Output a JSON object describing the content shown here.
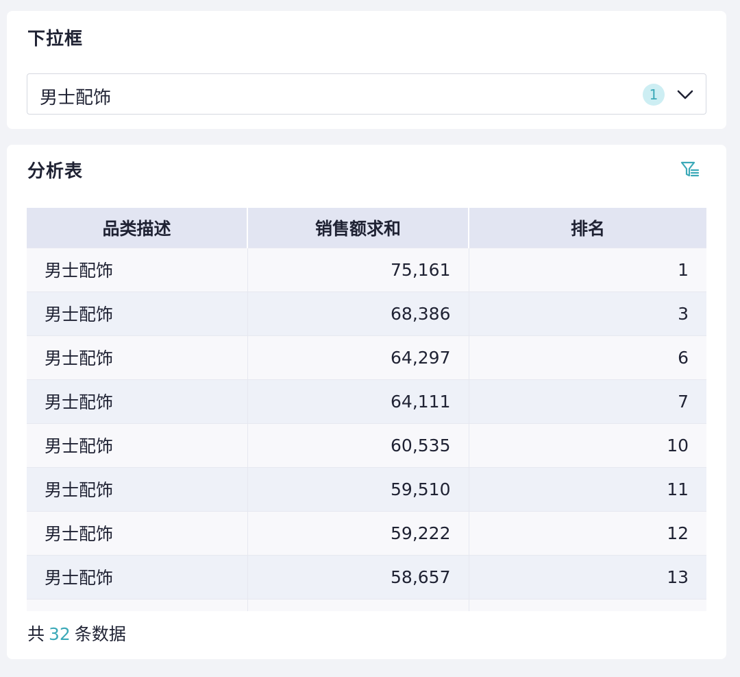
{
  "filter_card": {
    "title": "下拉框",
    "dropdown": {
      "selected_value": "男士配饰",
      "selected_count": "1"
    }
  },
  "table_card": {
    "title": "分析表",
    "columns": [
      "品类描述",
      "销售额求和",
      "排名"
    ],
    "rows": [
      {
        "category": "男士配饰",
        "sales": "75,161",
        "rank": "1"
      },
      {
        "category": "男士配饰",
        "sales": "68,386",
        "rank": "3"
      },
      {
        "category": "男士配饰",
        "sales": "64,297",
        "rank": "6"
      },
      {
        "category": "男士配饰",
        "sales": "64,111",
        "rank": "7"
      },
      {
        "category": "男士配饰",
        "sales": "60,535",
        "rank": "10"
      },
      {
        "category": "男士配饰",
        "sales": "59,510",
        "rank": "11"
      },
      {
        "category": "男士配饰",
        "sales": "59,222",
        "rank": "12"
      },
      {
        "category": "男士配饰",
        "sales": "58,657",
        "rank": "13"
      }
    ],
    "footer": {
      "prefix": "共",
      "total": "32",
      "suffix": "条数据"
    }
  },
  "colors": {
    "accent": "#3ba9b8",
    "header_bg": "#e2e5f2",
    "row_even_bg": "#eef1f8",
    "row_odd_bg": "#f8f8fb"
  },
  "icons": {
    "dropdown": "chevron-down-icon",
    "filter": "filter-list-icon"
  }
}
